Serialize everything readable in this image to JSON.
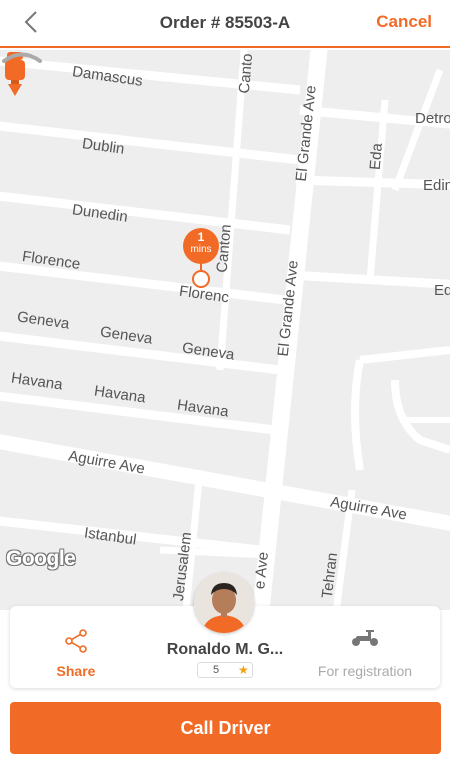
{
  "header": {
    "title": "Order # 85503-A",
    "cancel_label": "Cancel"
  },
  "map": {
    "streets": {
      "damascus": "Damascus",
      "dublin": "Dublin",
      "dunedin": "Dunedin",
      "florence_1": "Florence",
      "florence_2": "Florenc",
      "geneva_1": "Geneva",
      "geneva_2": "Geneva",
      "geneva_3": "Geneva",
      "havana_1": "Havana",
      "havana_2": "Havana",
      "havana_3": "Havana",
      "aguirre_1": "Aguirre Ave",
      "aguirre_2": "Aguirre Ave",
      "istanbul": "Istanbul",
      "jerusalem": "Jerusalem",
      "tehran": "Tehran",
      "canton_1": "Canton",
      "canton_2": "Canto",
      "el_grande_1": "El Grande Ave",
      "el_grande_2": "El Grande Ave",
      "el_grande_3": "e Ave",
      "eda": "Eda",
      "detro": "Detro",
      "edin": "Edin",
      "ed": "Ed"
    },
    "google_logo": "Google",
    "eta_value": "1",
    "eta_unit": "mins"
  },
  "driver": {
    "name": "Ronaldo M. G...",
    "rating": "5"
  },
  "actions": {
    "share_label": "Share",
    "registration_label": "For registration",
    "call_label": "Call Driver"
  },
  "colors": {
    "accent": "#f26b26",
    "star": "#f3a20f"
  },
  "icons": {
    "back": "chevron-left-icon",
    "share": "share-icon",
    "scooter": "scooter-icon",
    "star": "star-icon"
  }
}
